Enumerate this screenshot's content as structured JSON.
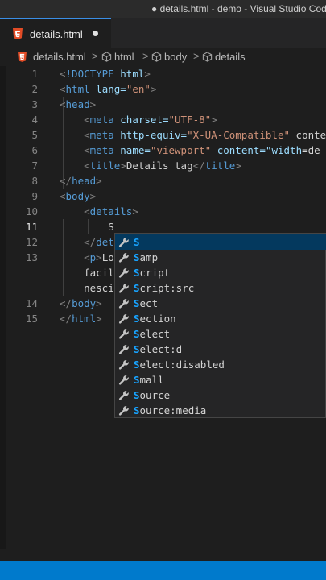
{
  "window": {
    "title": "● details.html - demo - Visual Studio Code"
  },
  "tab": {
    "label": "details.html",
    "modified": true
  },
  "breadcrumb": {
    "items": [
      "details.html",
      "html",
      "body",
      "details"
    ]
  },
  "editor": {
    "active_line": 11,
    "lines": [
      {
        "num": "1",
        "code": "<!DOCTYPE html>"
      },
      {
        "num": "2",
        "code": "<html lang=\"en\">"
      },
      {
        "num": "3",
        "code": "<head>"
      },
      {
        "num": "4",
        "code": "    <meta charset=\"UTF-8\">"
      },
      {
        "num": "5",
        "code": "    <meta http-equiv=\"X-UA-Compatible\" conte"
      },
      {
        "num": "6",
        "code": "    <meta name=\"viewport\" content=\"width=de"
      },
      {
        "num": "7",
        "code": "    <title>Details tag</title>"
      },
      {
        "num": "8",
        "code": "</head>"
      },
      {
        "num": "9",
        "code": "<body>"
      },
      {
        "num": "10",
        "code": "    <details>"
      },
      {
        "num": "11",
        "code": "        S"
      },
      {
        "num": "12",
        "code": "    </det"
      },
      {
        "num": "13",
        "code": "    <p>Lo"
      },
      {
        "num": "",
        "code": "    facil"
      },
      {
        "num": "",
        "code": "    nesci"
      },
      {
        "num": "14",
        "code": "</body>"
      },
      {
        "num": "15",
        "code": "</html>"
      }
    ]
  },
  "suggestions": {
    "selected_index": 0,
    "items": [
      "S",
      "Samp",
      "Script",
      "Script:src",
      "Sect",
      "Section",
      "Select",
      "Select:d",
      "Select:disabled",
      "Small",
      "Source",
      "Source:media"
    ]
  },
  "colors": {
    "tag": "#569cd6",
    "attr": "#9cdcfe",
    "string": "#ce9178",
    "text": "#d4d4d4",
    "accent": "#007acc",
    "html_icon": "#e34c26"
  }
}
